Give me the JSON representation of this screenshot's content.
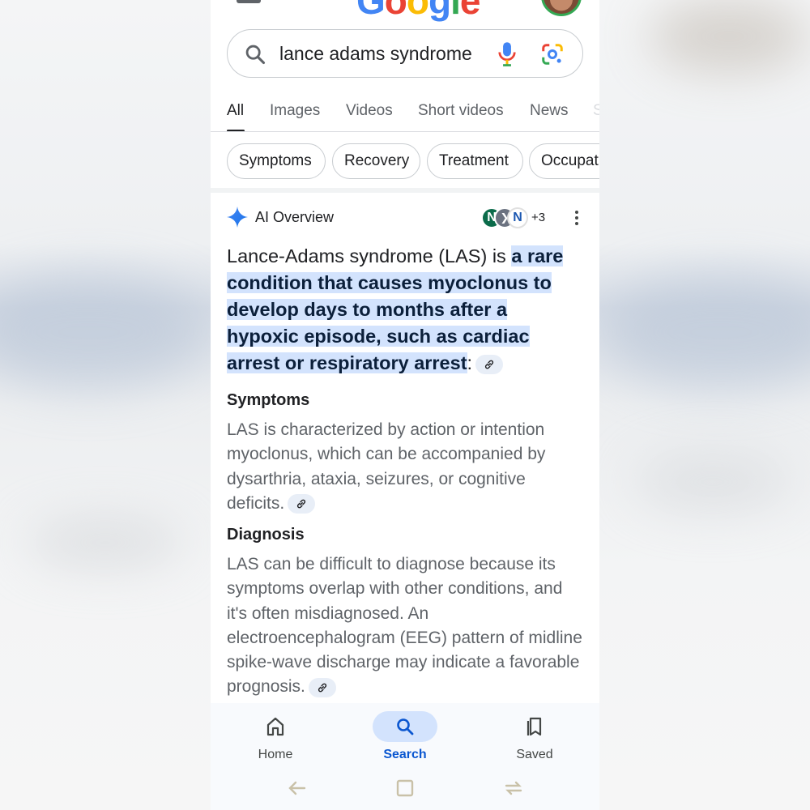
{
  "search": {
    "query": "lance adams syndrome"
  },
  "tabs": [
    {
      "label": "All",
      "active": true
    },
    {
      "label": "Images"
    },
    {
      "label": "Videos"
    },
    {
      "label": "Short videos"
    },
    {
      "label": "News"
    },
    {
      "label": "S"
    }
  ],
  "chips": [
    "Symptoms",
    "Recovery",
    "Treatment",
    "Occupat"
  ],
  "ai_overview": {
    "title": "AI Overview",
    "source_avatars": [
      "N",
      "❯",
      "N"
    ],
    "source_count": "+3",
    "intro_plain": "Lance-Adams syndrome (LAS) is ",
    "intro_highlight": "a rare condition that causes myoclonus to develop days to months after a hypoxic episode, such as cardiac arrest or respiratory arrest",
    "intro_end": ":",
    "sections": [
      {
        "heading": "Symptoms",
        "text": "LAS is characterized by action or intention myoclonus, which can be accompanied by dysarthria, ataxia, seizures, or cognitive deficits."
      },
      {
        "heading": "Diagnosis",
        "text": "LAS can be difficult to diagnose because its symptoms overlap with other conditions, and it's often misdiagnosed. An electroencephalogram (EEG) pattern of midline spike-wave discharge may indicate a favorable prognosis."
      }
    ]
  },
  "bottom_nav": [
    {
      "label": "Home",
      "icon": "home-icon"
    },
    {
      "label": "Search",
      "icon": "search-icon",
      "active": true
    },
    {
      "label": "Saved",
      "icon": "bookmarks-icon"
    }
  ],
  "colors": {
    "accent": "#0b57d0",
    "highlight": "#d3e3fd",
    "text": "#202124",
    "muted": "#5f6368"
  }
}
